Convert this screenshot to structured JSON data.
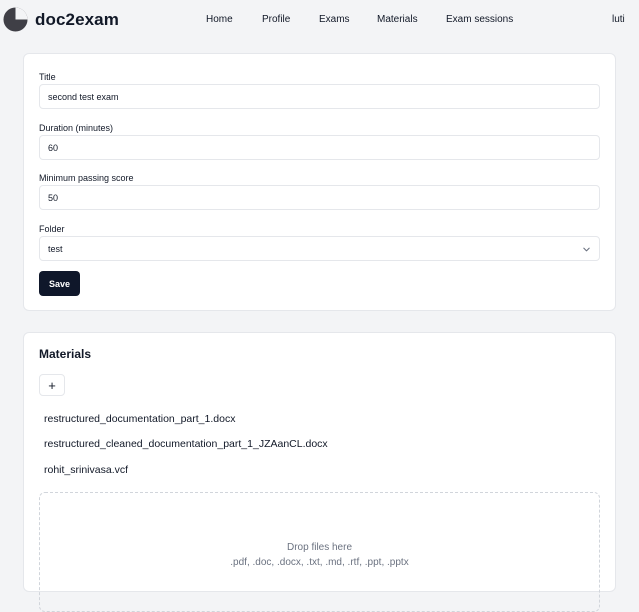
{
  "header": {
    "brand": "doc2exam",
    "nav": [
      "Home",
      "Profile",
      "Exams",
      "Materials",
      "Exam sessions"
    ],
    "user": "luti"
  },
  "exam_form": {
    "title_label": "Title",
    "title_value": "second test exam",
    "duration_label": "Duration (minutes)",
    "duration_value": "60",
    "min_score_label": "Minimum passing score",
    "min_score_value": "50",
    "folder_label": "Folder",
    "folder_value": "test",
    "save_label": "Save"
  },
  "materials": {
    "title": "Materials",
    "add_label": "+",
    "files": [
      "restructured_documentation_part_1.docx",
      "restructured_cleaned_documentation_part_1_JZAanCL.docx",
      "rohit_srinivasa.vcf"
    ],
    "dropzone_title": "Drop files here",
    "dropzone_types": ".pdf, .doc, .docx, .txt, .md, .rtf, .ppt, .pptx"
  },
  "colors": {
    "background": "#f3f4f6",
    "card": "#ffffff",
    "primary_button": "#0f172a",
    "border": "#e5e7eb",
    "muted_text": "#6b7280"
  },
  "icons": {
    "logo": "doc2exam-logo-icon",
    "select": "chevron-down-icon",
    "add": "plus-icon"
  }
}
